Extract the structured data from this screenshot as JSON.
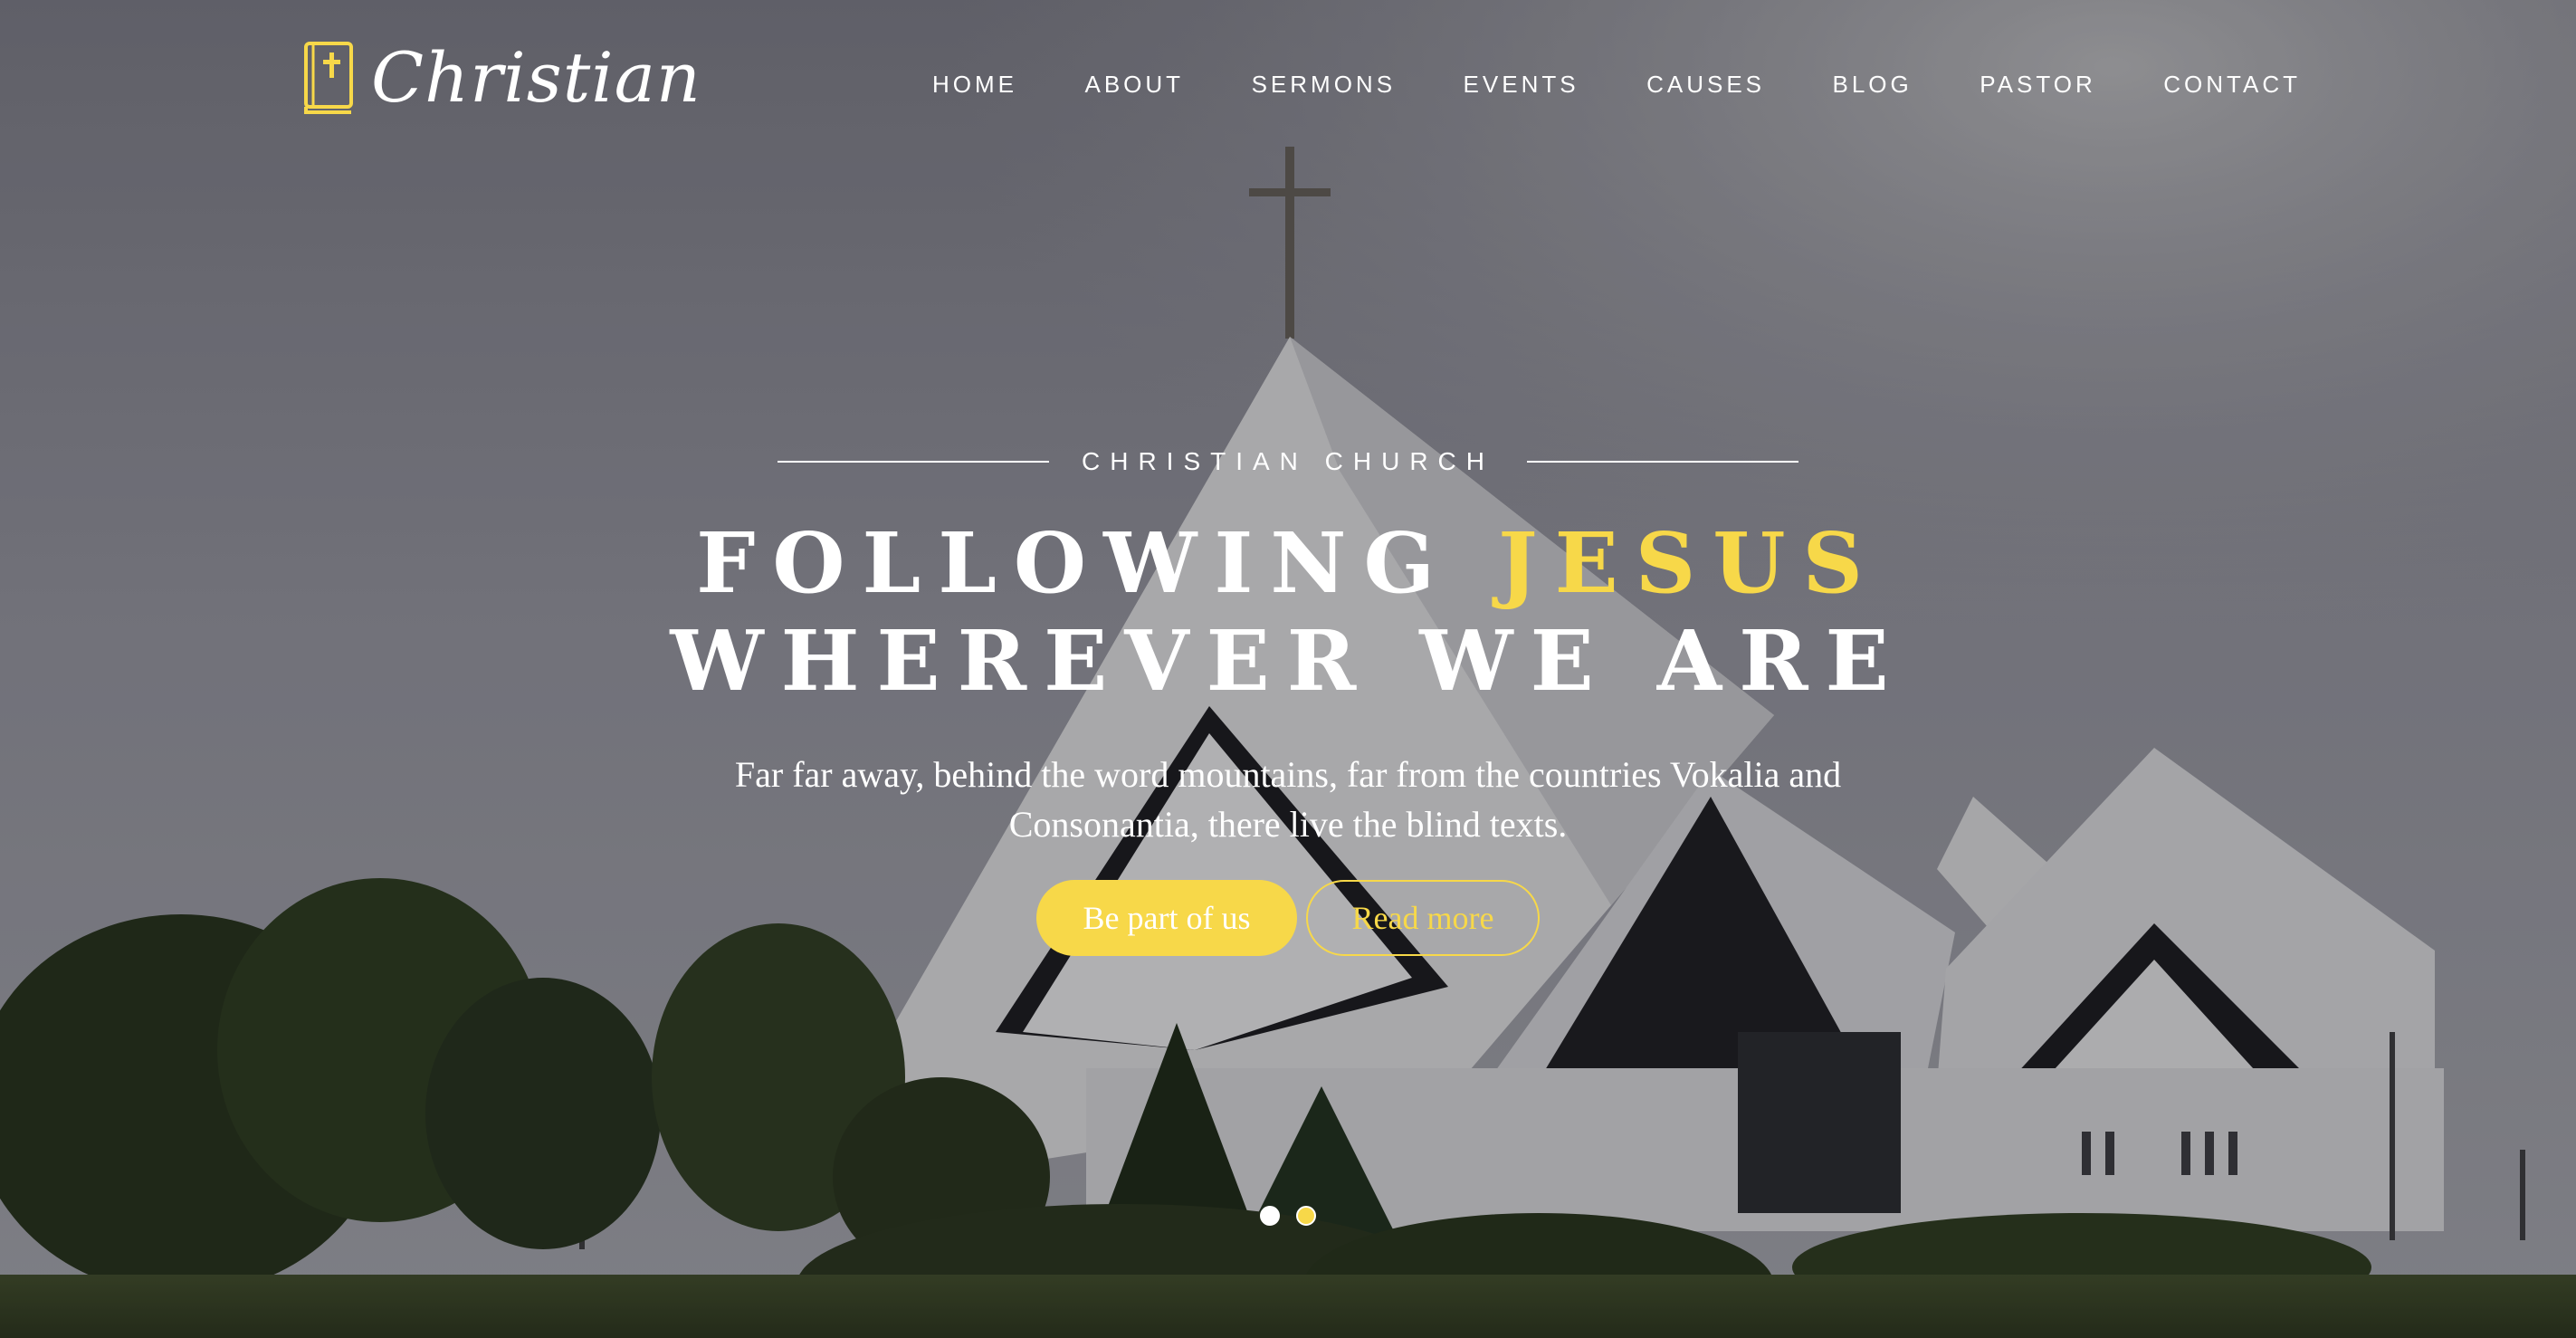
{
  "brand": {
    "name": "Christian",
    "icon": "bible-icon",
    "accent_color": "#f7d849"
  },
  "nav": {
    "items": [
      {
        "label": "HOME"
      },
      {
        "label": "ABOUT"
      },
      {
        "label": "SERMONS"
      },
      {
        "label": "EVENTS"
      },
      {
        "label": "CAUSES"
      },
      {
        "label": "BLOG"
      },
      {
        "label": "PASTOR"
      },
      {
        "label": "CONTACT"
      }
    ]
  },
  "hero": {
    "eyebrow": "CHRISTIAN CHURCH",
    "headline_part1": "FOLLOWING ",
    "headline_highlight": "JESUS",
    "headline_line2": "WHEREVER WE ARE",
    "subtitle_line1": "Far far away, behind the word mountains, far from the countries Vokalia and",
    "subtitle_line2": "Consonantia, there live the blind texts.",
    "primary_button": "Be part of us",
    "secondary_button": "Read more",
    "background_image": "church-building-photo"
  },
  "slider": {
    "slide_count": 2,
    "active_dot_colors": [
      "#ffffff",
      "#f7d849"
    ]
  }
}
